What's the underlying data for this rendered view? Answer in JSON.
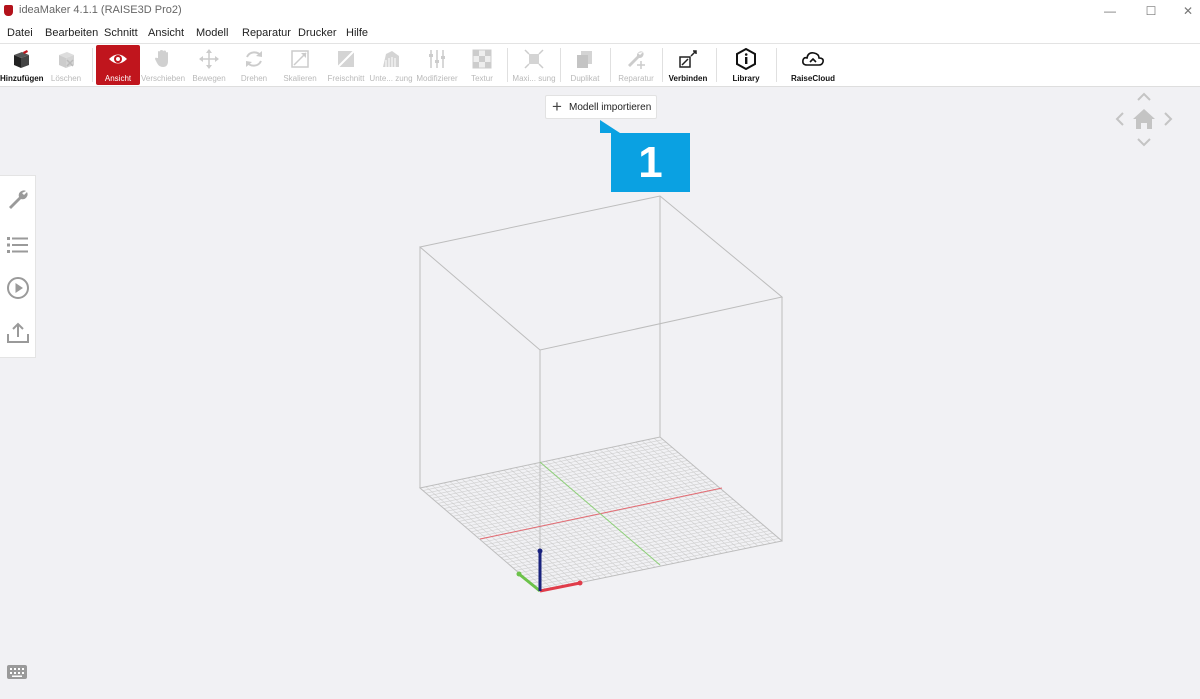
{
  "window": {
    "title": "ideaMaker 4.1.1 (RAISE3D Pro2)"
  },
  "menu": {
    "items": [
      "Datei",
      "Bearbeiten",
      "Schnitt",
      "Ansicht",
      "Modell",
      "Reparatur",
      "Drucker",
      "Hilfe"
    ]
  },
  "toolbar": {
    "add": "Hinzufügen",
    "delete": "Löschen",
    "view": "Ansicht",
    "move_view": "Verschieben",
    "move": "Bewegen",
    "rotate": "Drehen",
    "scale": "Skalieren",
    "freecut": "Freischnitt",
    "support": "Unte... zung",
    "modifier": "Modifizierer",
    "texture": "Textur",
    "maximize": "Maxi... sung",
    "duplicate": "Duplikat",
    "repair": "Reparatur",
    "connect": "Verbinden",
    "library": "Library",
    "raisecloud": "RaiseCloud"
  },
  "import": {
    "label": "Modell importieren"
  },
  "callout": {
    "number": "1"
  },
  "colors": {
    "accent": "#c0151d",
    "callout": "#0aa1e2",
    "x_axis": "#e03c4a",
    "y_axis": "#6cc24a",
    "z_axis": "#1a237e"
  },
  "icons": [
    "home-icon",
    "chevron-up-icon",
    "chevron-down-icon",
    "chevron-left-icon",
    "chevron-right-icon",
    "wrench-icon",
    "list-icon",
    "play-icon",
    "upload-icon",
    "keyboard-icon"
  ]
}
